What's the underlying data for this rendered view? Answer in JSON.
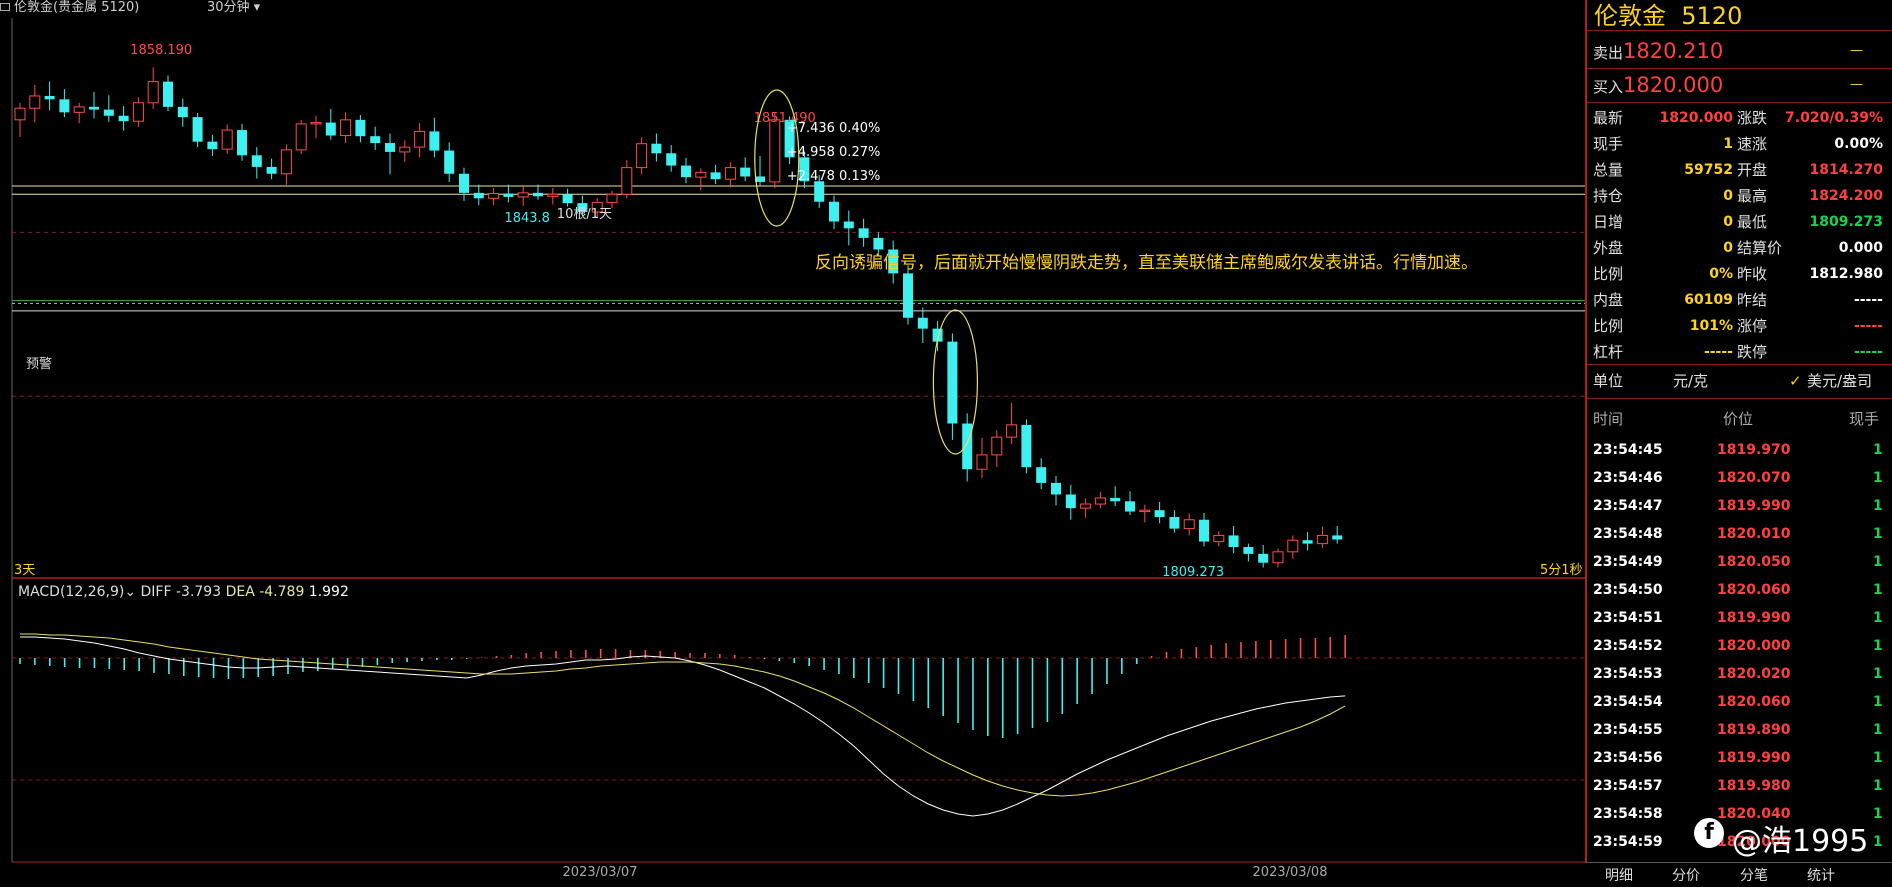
{
  "window": {
    "title": "伦敦金(贵金属 5120)",
    "period": "30分钟"
  },
  "chart_data": {
    "type": "candlestick",
    "annotations": {
      "high_label": "1858.190",
      "pullback_high": "1851.490",
      "pct_levels": [
        "+7.436  0.40%",
        "+4.958  0.27%",
        "+2.478  0.13%"
      ],
      "support_label": "1843.8",
      "retrace_tag": "10根/1天",
      "low_label": "1809.273",
      "comment": "反向诱骗信号，后面就开始慢慢阴跌走势，直至美联储主席鲍威尔发表讲话。行情加速。",
      "alert_label": "预警",
      "range_left": "3天",
      "range_right": "5分1秒"
    },
    "x_labels": [
      "2023/03/07",
      "2023/03/08"
    ],
    "candles": [
      [
        1850.5,
        1853.0,
        1848.0,
        1852.2
      ],
      [
        1852.2,
        1855.6,
        1850.1,
        1854.0
      ],
      [
        1854.0,
        1856.1,
        1851.9,
        1853.5
      ],
      [
        1853.5,
        1855.0,
        1850.9,
        1851.6
      ],
      [
        1851.6,
        1853.0,
        1850.0,
        1852.4
      ],
      [
        1852.4,
        1854.6,
        1850.7,
        1852.0
      ],
      [
        1852.0,
        1854.1,
        1850.2,
        1851.1
      ],
      [
        1851.1,
        1852.5,
        1848.9,
        1850.3
      ],
      [
        1850.3,
        1853.8,
        1849.5,
        1853.0
      ],
      [
        1853.0,
        1858.19,
        1852.1,
        1856.1
      ],
      [
        1856.1,
        1857.0,
        1851.8,
        1852.4
      ],
      [
        1852.4,
        1853.6,
        1849.5,
        1850.9
      ],
      [
        1850.9,
        1851.5,
        1846.5,
        1847.3
      ],
      [
        1847.3,
        1848.3,
        1845.2,
        1846.2
      ],
      [
        1846.2,
        1849.8,
        1845.5,
        1849.0
      ],
      [
        1849.0,
        1849.9,
        1844.5,
        1845.3
      ],
      [
        1845.3,
        1846.5,
        1841.9,
        1843.6
      ],
      [
        1843.6,
        1844.8,
        1841.8,
        1842.6
      ],
      [
        1842.6,
        1846.9,
        1841.0,
        1846.1
      ],
      [
        1846.1,
        1850.5,
        1845.5,
        1849.9
      ],
      [
        1849.9,
        1851.1,
        1847.8,
        1850.1
      ],
      [
        1850.1,
        1852.1,
        1847.6,
        1848.2
      ],
      [
        1848.2,
        1851.6,
        1847.1,
        1850.5
      ],
      [
        1850.5,
        1851.2,
        1847.2,
        1848.1
      ],
      [
        1848.1,
        1849.5,
        1846.1,
        1847.1
      ],
      [
        1847.1,
        1848.5,
        1842.5,
        1845.8
      ],
      [
        1845.8,
        1847.5,
        1844.3,
        1846.5
      ],
      [
        1846.5,
        1850.0,
        1845.0,
        1848.8
      ],
      [
        1848.8,
        1850.8,
        1845.0,
        1846.0
      ],
      [
        1846.0,
        1847.2,
        1841.4,
        1842.6
      ],
      [
        1842.6,
        1843.5,
        1838.6,
        1839.8
      ],
      [
        1839.8,
        1841.0,
        1838.0,
        1839.0
      ],
      [
        1839.0,
        1840.5,
        1838.0,
        1839.7
      ],
      [
        1839.7,
        1841.0,
        1838.4,
        1839.2
      ],
      [
        1839.2,
        1840.7,
        1837.9,
        1839.8
      ],
      [
        1839.8,
        1841.0,
        1838.8,
        1839.3
      ],
      [
        1839.3,
        1840.5,
        1838.1,
        1839.6
      ],
      [
        1839.6,
        1840.4,
        1837.8,
        1838.3
      ],
      [
        1838.3,
        1839.4,
        1836.5,
        1837.0
      ],
      [
        1837.0,
        1839.0,
        1836.2,
        1838.4
      ],
      [
        1838.4,
        1840.1,
        1837.6,
        1839.6
      ],
      [
        1839.6,
        1844.6,
        1839.0,
        1843.5
      ],
      [
        1843.5,
        1847.9,
        1842.5,
        1847.0
      ],
      [
        1847.0,
        1848.5,
        1844.4,
        1845.6
      ],
      [
        1845.6,
        1846.8,
        1842.9,
        1843.8
      ],
      [
        1843.8,
        1844.9,
        1841.2,
        1842.1
      ],
      [
        1842.1,
        1843.4,
        1840.2,
        1842.8
      ],
      [
        1842.8,
        1843.9,
        1841.1,
        1841.8
      ],
      [
        1841.8,
        1844.3,
        1840.6,
        1843.5
      ],
      [
        1843.5,
        1845.0,
        1841.5,
        1842.2
      ],
      [
        1842.2,
        1845.2,
        1840.9,
        1841.4
      ],
      [
        1841.4,
        1851.49,
        1840.5,
        1850.5
      ],
      [
        1850.5,
        1851.0,
        1844.0,
        1845.0
      ],
      [
        1845.0,
        1845.9,
        1840.5,
        1841.5
      ],
      [
        1841.5,
        1842.4,
        1837.6,
        1838.5
      ],
      [
        1838.5,
        1839.4,
        1834.5,
        1835.6
      ],
      [
        1835.6,
        1837.2,
        1832.1,
        1834.6
      ],
      [
        1834.6,
        1836.0,
        1831.9,
        1833.2
      ],
      [
        1833.2,
        1834.0,
        1830.6,
        1831.5
      ],
      [
        1831.5,
        1832.8,
        1826.5,
        1828.0
      ],
      [
        1828.0,
        1829.2,
        1820.5,
        1821.5
      ],
      [
        1821.5,
        1823.0,
        1817.8,
        1819.9
      ],
      [
        1819.9,
        1821.0,
        1816.6,
        1818.0
      ],
      [
        1818.0,
        1819.2,
        1803.6,
        1806.0
      ],
      [
        1806.0,
        1807.5,
        1797.5,
        1799.3
      ],
      [
        1799.3,
        1803.9,
        1798.0,
        1801.4
      ],
      [
        1801.4,
        1805.0,
        1799.6,
        1804.0
      ],
      [
        1804.0,
        1809.0,
        1803.0,
        1805.8
      ],
      [
        1805.8,
        1806.6,
        1798.7,
        1799.6
      ],
      [
        1799.6,
        1800.9,
        1796.4,
        1797.3
      ],
      [
        1797.3,
        1798.3,
        1794.0,
        1795.6
      ],
      [
        1795.6,
        1797.0,
        1791.9,
        1793.6
      ],
      [
        1793.6,
        1795.0,
        1792.2,
        1794.2
      ],
      [
        1794.2,
        1796.0,
        1793.6,
        1795.1
      ],
      [
        1795.1,
        1796.8,
        1793.9,
        1794.6
      ],
      [
        1794.6,
        1796.1,
        1792.6,
        1793.1
      ],
      [
        1793.1,
        1794.1,
        1791.5,
        1793.3
      ],
      [
        1793.3,
        1794.5,
        1791.4,
        1792.3
      ],
      [
        1792.3,
        1793.3,
        1790.0,
        1790.6
      ],
      [
        1790.6,
        1792.8,
        1789.6,
        1791.9
      ],
      [
        1791.9,
        1792.9,
        1788.0,
        1788.7
      ],
      [
        1788.7,
        1790.2,
        1788.0,
        1789.6
      ],
      [
        1789.6,
        1791.0,
        1787.0,
        1787.9
      ],
      [
        1787.9,
        1788.4,
        1785.8,
        1786.9
      ],
      [
        1786.9,
        1788.2,
        1784.9,
        1785.6
      ],
      [
        1785.6,
        1787.7,
        1784.9,
        1787.2
      ],
      [
        1787.2,
        1789.6,
        1786.2,
        1788.9
      ],
      [
        1788.9,
        1790.1,
        1787.4,
        1788.4
      ],
      [
        1788.4,
        1790.9,
        1787.8,
        1789.6
      ],
      [
        1789.6,
        1791.0,
        1788.4,
        1789.0
      ]
    ],
    "hlines": {
      "yellow": [
        1840.8,
        1839.6
      ],
      "green": 1824.0,
      "white": 1822.5,
      "alert": 1823.6,
      "red_dashed": [
        1834.0,
        1810.0
      ]
    },
    "macd": {
      "label": "MACD(12,26,9)",
      "diff_label": "DIFF -3.793",
      "dea_label": "DEA -4.789",
      "value_label": "1.992",
      "hist": [
        -0.6,
        -0.7,
        -0.8,
        -0.9,
        -1.0,
        -1.0,
        -1.1,
        -1.2,
        -1.3,
        -1.5,
        -1.6,
        -1.8,
        -1.9,
        -2.0,
        -2.1,
        -2.0,
        -1.9,
        -1.8,
        -1.6,
        -1.4,
        -1.3,
        -1.1,
        -1.0,
        -0.9,
        -0.7,
        -0.5,
        -0.4,
        -0.3,
        -0.2,
        -0.2,
        -0.1,
        0.05,
        0.2,
        0.3,
        0.5,
        0.6,
        0.7,
        0.8,
        0.8,
        0.9,
        0.9,
        0.8,
        0.8,
        0.7,
        0.6,
        0.5,
        0.5,
        0.4,
        0.3,
        0.1,
        -0.1,
        -0.3,
        -0.5,
        -0.8,
        -1.2,
        -1.6,
        -2.0,
        -2.5,
        -3.0,
        -3.6,
        -4.3,
        -5.0,
        -5.8,
        -6.5,
        -7.2,
        -7.8,
        -8.0,
        -7.6,
        -7.0,
        -6.4,
        -5.6,
        -4.6,
        -3.6,
        -2.6,
        -1.6,
        -0.6,
        0.2,
        0.6,
        0.9,
        1.1,
        1.3,
        1.5,
        1.6,
        1.7,
        1.8,
        1.9,
        2.0,
        2.0,
        2.1,
        2.3
      ],
      "diff": [
        2.1,
        2.1,
        2.0,
        1.9,
        1.7,
        1.5,
        1.2,
        0.9,
        0.5,
        0.2,
        -0.1,
        -0.3,
        -0.5,
        -0.7,
        -0.9,
        -1.0,
        -1.0,
        -0.9,
        -0.8,
        -0.9,
        -1.0,
        -1.1,
        -1.2,
        -1.3,
        -1.4,
        -1.5,
        -1.6,
        -1.7,
        -1.8,
        -1.9,
        -2.0,
        -1.7,
        -1.3,
        -1.0,
        -0.8,
        -0.7,
        -0.6,
        -0.4,
        -0.2,
        -0.2,
        -0.1,
        0.1,
        0.2,
        0.1,
        0.0,
        -0.3,
        -0.7,
        -1.2,
        -1.8,
        -2.4,
        -3.0,
        -3.8,
        -4.6,
        -5.5,
        -6.5,
        -7.6,
        -8.8,
        -10.2,
        -11.6,
        -12.8,
        -13.8,
        -14.6,
        -15.2,
        -15.6,
        -15.8,
        -15.6,
        -15.2,
        -14.6,
        -13.9,
        -13.2,
        -12.4,
        -11.6,
        -10.9,
        -10.2,
        -9.6,
        -9.0,
        -8.4,
        -7.8,
        -7.3,
        -6.8,
        -6.3,
        -5.9,
        -5.5,
        -5.1,
        -4.8,
        -4.5,
        -4.3,
        -4.1,
        -3.9,
        -3.793
      ],
      "dea": [
        2.4,
        2.4,
        2.3,
        2.3,
        2.2,
        2.1,
        2.0,
        1.8,
        1.6,
        1.4,
        1.1,
        0.9,
        0.7,
        0.5,
        0.3,
        0.1,
        -0.1,
        -0.2,
        -0.3,
        -0.4,
        -0.5,
        -0.6,
        -0.7,
        -0.8,
        -0.9,
        -1.0,
        -1.1,
        -1.2,
        -1.3,
        -1.4,
        -1.5,
        -1.6,
        -1.6,
        -1.6,
        -1.5,
        -1.4,
        -1.3,
        -1.1,
        -1.0,
        -0.8,
        -0.7,
        -0.6,
        -0.5,
        -0.4,
        -0.4,
        -0.4,
        -0.5,
        -0.6,
        -0.8,
        -1.1,
        -1.4,
        -1.8,
        -2.3,
        -2.9,
        -3.5,
        -4.2,
        -5.0,
        -5.9,
        -6.8,
        -7.7,
        -8.6,
        -9.5,
        -10.3,
        -11.0,
        -11.7,
        -12.3,
        -12.8,
        -13.2,
        -13.5,
        -13.7,
        -13.8,
        -13.7,
        -13.5,
        -13.2,
        -12.8,
        -12.4,
        -11.9,
        -11.4,
        -10.9,
        -10.4,
        -9.9,
        -9.4,
        -8.9,
        -8.4,
        -7.9,
        -7.4,
        -6.9,
        -6.3,
        -5.6,
        -4.789
      ]
    }
  },
  "quote": {
    "name": "伦敦金",
    "code": "5120",
    "sell_label": "卖出",
    "sell_price": "1820.210",
    "sell_vol": "—",
    "buy_label": "买入",
    "buy_price": "1820.000",
    "buy_vol": "—",
    "rows": [
      {
        "l1": "最新",
        "v1": "1820.000",
        "c1": "red",
        "l2": "涨跌",
        "v2": "7.020/0.39%",
        "c2": "red"
      },
      {
        "l1": "现手",
        "v1": "1",
        "c1": "yel",
        "l2": "速涨",
        "v2": "0.00%",
        "c2": "wht"
      },
      {
        "l1": "总量",
        "v1": "59752",
        "c1": "yel",
        "l2": "开盘",
        "v2": "1814.270",
        "c2": "red"
      },
      {
        "l1": "持仓",
        "v1": "0",
        "c1": "yel",
        "l2": "最高",
        "v2": "1824.200",
        "c2": "red"
      },
      {
        "l1": "日增",
        "v1": "0",
        "c1": "yel",
        "l2": "最低",
        "v2": "1809.273",
        "c2": "grn"
      },
      {
        "l1": "外盘",
        "v1": "0",
        "c1": "yel",
        "l2": "结算价",
        "v2": "0.000",
        "c2": "wht"
      },
      {
        "l1": "比例",
        "v1": "0%",
        "c1": "yel",
        "l2": "昨收",
        "v2": "1812.980",
        "c2": "wht"
      },
      {
        "l1": "内盘",
        "v1": "60109",
        "c1": "yel",
        "l2": "昨结",
        "v2": "-----",
        "c2": "wht"
      },
      {
        "l1": "比例",
        "v1": "101%",
        "c1": "yel",
        "l2": "涨停",
        "v2": "-----",
        "c2": "red"
      },
      {
        "l1": "杠杆",
        "v1": "-----",
        "c1": "yel",
        "l2": "跌停",
        "v2": "-----",
        "c2": "grn"
      }
    ],
    "unit_label": "单位",
    "unit_value": "元/克",
    "unit_alt": "美元/盎司",
    "ticks_header": {
      "time": "时间",
      "price": "价位",
      "vol": "现手"
    },
    "ticks": [
      [
        "23:54:45",
        "1819.970",
        "1"
      ],
      [
        "23:54:46",
        "1820.070",
        "1"
      ],
      [
        "23:54:47",
        "1819.990",
        "1"
      ],
      [
        "23:54:48",
        "1820.010",
        "1"
      ],
      [
        "23:54:49",
        "1820.050",
        "1"
      ],
      [
        "23:54:50",
        "1820.060",
        "1"
      ],
      [
        "23:54:51",
        "1819.990",
        "1"
      ],
      [
        "23:54:52",
        "1820.000",
        "1"
      ],
      [
        "23:54:53",
        "1820.020",
        "1"
      ],
      [
        "23:54:54",
        "1820.060",
        "1"
      ],
      [
        "23:54:55",
        "1819.890",
        "1"
      ],
      [
        "23:54:56",
        "1819.990",
        "1"
      ],
      [
        "23:54:57",
        "1819.980",
        "1"
      ],
      [
        "23:54:58",
        "1820.040",
        "1"
      ],
      [
        "23:54:59",
        "1820.000",
        "1"
      ]
    ],
    "tabs": [
      "明细",
      "分价",
      "分笔",
      "统计"
    ],
    "watermark": "@浩1995"
  }
}
